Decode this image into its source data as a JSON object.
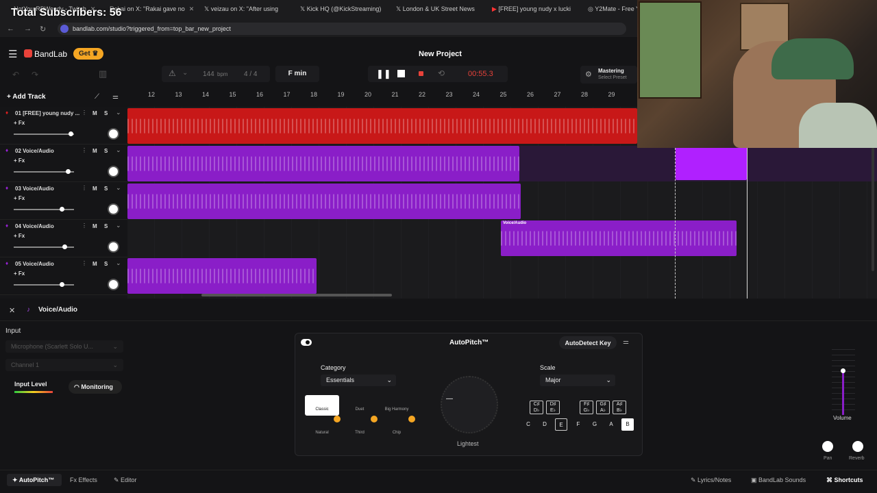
{
  "overlay_text": "Total Subscribers: 56",
  "browser": {
    "tabs": [
      {
        "label": "NotYourRBWendy - Twitch"
      },
      {
        "label": "Rakai on X: \"Rakai gave no"
      },
      {
        "label": "veizau on X: \"After using"
      },
      {
        "label": "Kick HQ (@KickStreaming)"
      },
      {
        "label": "London & UK Street News"
      },
      {
        "label": "[FREE] young nudy x lucki"
      },
      {
        "label": "Y2Mate - Free Y"
      }
    ],
    "url": "bandlab.com/studio?triggered_from=top_bar_new_project"
  },
  "app": {
    "brand": "BandLab",
    "get_label": "Get",
    "project_title": "New Project",
    "bpm": "144",
    "bpm_unit": "bpm",
    "time_sig": "4 / 4",
    "key": "F min",
    "time": "00:55.3",
    "mastering_title": "Mastering",
    "mastering_sub": "Select Preset",
    "add_track": "Add Track"
  },
  "ruler": [
    "12",
    "13",
    "14",
    "15",
    "16",
    "17",
    "18",
    "19",
    "20",
    "21",
    "22",
    "23",
    "24",
    "25",
    "26",
    "27",
    "28",
    "29"
  ],
  "tracks": [
    {
      "name": "01 [FREE] young nudy ...",
      "fx": "+ Fx",
      "m": "M",
      "s": "S",
      "color": "#e02020",
      "volume": 0.95
    },
    {
      "name": "02 Voice/Audio",
      "fx": "+ Fx",
      "m": "M",
      "s": "S",
      "color": "#9a22d9",
      "volume": 0.91
    },
    {
      "name": "03 Voice/Audio",
      "fx": "+ Fx",
      "m": "M",
      "s": "S",
      "color": "#9a22d9",
      "volume": 0.81
    },
    {
      "name": "04 Voice/Audio",
      "fx": "+ Fx",
      "m": "M",
      "s": "S",
      "color": "#9a22d9",
      "volume": 0.85
    },
    {
      "name": "05 Voice/Audio",
      "fx": "+ Fx",
      "m": "M",
      "s": "S",
      "color": "#9a22d9",
      "volume": 0.81
    }
  ],
  "clip_label": "Voice/Audio",
  "panel": {
    "track_name": "Voice/Audio",
    "input_title": "Input",
    "input_device": "Microphone (Scarlett Solo U...",
    "channel": "Channel 1",
    "input_level": "Input Level",
    "monitoring": "Monitoring"
  },
  "autopitch": {
    "title": "AutoPitch™",
    "autodetect": "AutoDetect Key",
    "category_label": "Category",
    "category_value": "Essentials",
    "scale_label": "Scale",
    "scale_value": "Major",
    "knob_label": "Lightest",
    "presets": [
      "Classic",
      "Duet",
      "Big Harmony",
      "Natural",
      "Third",
      "Chip"
    ],
    "sharps": [
      "C♯ D♭",
      "D♯ E♭",
      "F♯ G♭",
      "G♯ A♭",
      "A♯ B♭"
    ],
    "keys": [
      "C",
      "D",
      "E",
      "F",
      "G",
      "A",
      "B"
    ]
  },
  "mixer": {
    "volume": "Volume",
    "pan": "Pan",
    "reverb": "Reverb"
  },
  "footer": {
    "autopitch": "AutoPitch™",
    "effects": "Effects",
    "editor": "Editor",
    "lyrics": "Lyrics/Notes",
    "sounds": "BandLab Sounds",
    "shortcuts": "Shortcuts"
  },
  "colors": {
    "accent": "#e8423a",
    "get": "#f5a623",
    "audio_clip": "#9a22d9",
    "beat_clip": "#e02020"
  }
}
